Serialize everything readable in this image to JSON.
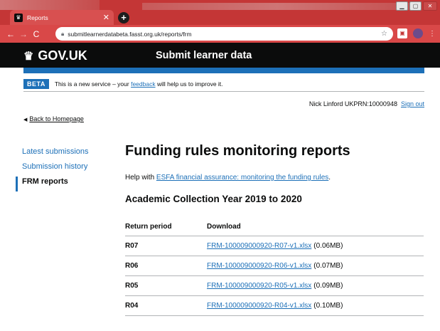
{
  "browser": {
    "tab_title": "Reports",
    "url": "submitlearnerdatabeta.fasst.org.uk/reports/frm"
  },
  "header": {
    "logo_text": "GOV.UK",
    "service_name": "Submit learner data"
  },
  "phase_banner": {
    "tag": "BETA",
    "text_before": "This is a new service – your ",
    "link_text": "feedback",
    "text_after": " will help us to improve it."
  },
  "user": {
    "info": "Nick Linford UKPRN:10000948",
    "sign_out": "Sign out"
  },
  "back_link": "Back to Homepage",
  "sidebar": {
    "items": [
      {
        "label": "Latest submissions"
      },
      {
        "label": "Submission history"
      },
      {
        "label": "FRM reports"
      }
    ]
  },
  "main": {
    "title": "Funding rules monitoring reports",
    "help_prefix": "Help with ",
    "help_link": "ESFA financial assurance: monitoring the funding rules",
    "help_suffix": ".",
    "year_heading": "Academic Collection Year 2019 to 2020",
    "table": {
      "headers": [
        "Return period",
        "Download"
      ],
      "rows": [
        {
          "period": "R07",
          "file": "FRM-100009000920-R07-v1.xlsx",
          "size": "(0.06MB)"
        },
        {
          "period": "R06",
          "file": "FRM-100009000920-R06-v1.xlsx",
          "size": "(0.07MB)"
        },
        {
          "period": "R05",
          "file": "FRM-100009000920-R05-v1.xlsx",
          "size": "(0.09MB)"
        },
        {
          "period": "R04",
          "file": "FRM-100009000920-R04-v1.xlsx",
          "size": "(0.10MB)"
        }
      ]
    }
  },
  "colors": {
    "browser_chrome": "#c43636",
    "gov_black": "#0b0c0c",
    "gov_blue": "#1d70b8",
    "border": "#b1b4b6"
  }
}
